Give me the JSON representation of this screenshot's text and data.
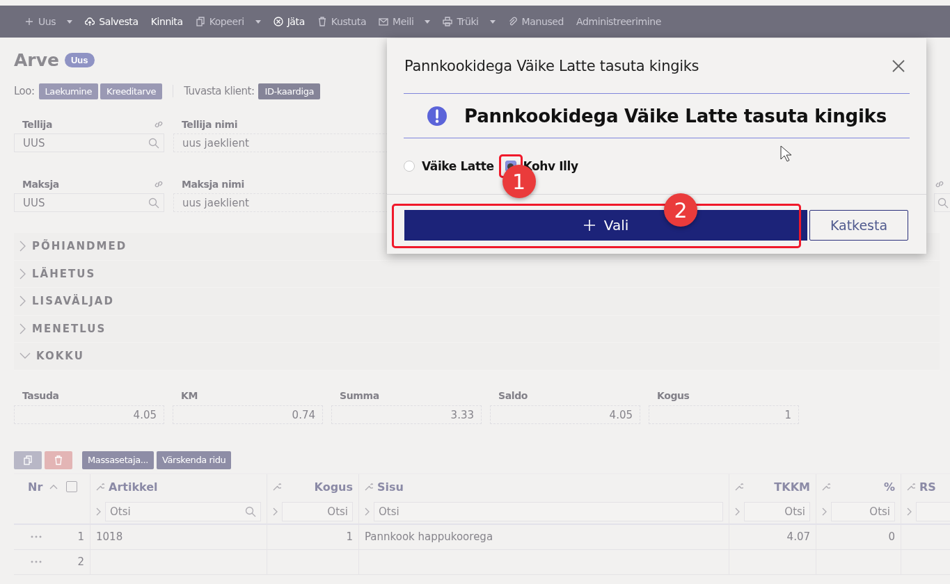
{
  "toolbar": {
    "items": [
      {
        "label": "Uus",
        "kind": "plus",
        "dropdown": true,
        "disabled": true
      },
      {
        "label": "Salvesta",
        "kind": "upload",
        "dropdown": false,
        "disabled": false
      },
      {
        "label": "Kinnita",
        "kind": "plain",
        "dropdown": false,
        "disabled": false
      },
      {
        "label": "Kopeeri",
        "kind": "copy",
        "dropdown": true,
        "disabled": true
      },
      {
        "label": "Jäta",
        "kind": "cancel",
        "dropdown": false,
        "disabled": false
      },
      {
        "label": "Kustuta",
        "kind": "trash",
        "dropdown": false,
        "disabled": true
      },
      {
        "label": "Meili",
        "kind": "mail",
        "dropdown": true,
        "disabled": true
      },
      {
        "label": "Trüki",
        "kind": "print",
        "dropdown": true,
        "disabled": true
      },
      {
        "label": "Manused",
        "kind": "clip",
        "dropdown": false,
        "disabled": true
      },
      {
        "label": "Administreerimine",
        "kind": "plain",
        "dropdown": false,
        "disabled": true
      }
    ]
  },
  "header": {
    "title": "Arve",
    "badge": "Uus",
    "create_label": "Loo:",
    "create_buttons": [
      "Laekumine",
      "Kreeditarve"
    ],
    "identify_label": "Tuvasta klient:",
    "identify_button": "ID-kaardiga"
  },
  "field_rows": [
    [
      {
        "label": "Tellija",
        "value": "UUS",
        "kind": "lookup"
      },
      {
        "label": "Tellija nimi",
        "value": "uus jaeklient",
        "kind": "text"
      }
    ],
    [
      {
        "label": "Maksja",
        "value": "UUS",
        "kind": "lookup"
      },
      {
        "label": "Maksja nimi",
        "value": "uus jaeklient",
        "kind": "text"
      },
      {
        "kind": "cut"
      }
    ]
  ],
  "sections": [
    {
      "label": "PÕHIANDMED",
      "expanded": false
    },
    {
      "label": "LÄHETUS",
      "expanded": false
    },
    {
      "label": "LISAVÄLJAD",
      "expanded": false
    },
    {
      "label": "MENETLUS",
      "expanded": false
    },
    {
      "label": "KOKKU",
      "expanded": true
    }
  ],
  "totals": [
    {
      "label": "Tasuda",
      "value": "4.05"
    },
    {
      "label": "KM",
      "value": "0.74"
    },
    {
      "label": "Summa",
      "value": "3.33"
    },
    {
      "label": "Saldo",
      "value": "4.05"
    },
    {
      "label": "Kogus",
      "value": "1"
    }
  ],
  "table_toolbar": {
    "buttons": [
      "Massasetaja...",
      "Värskenda ridu"
    ]
  },
  "table": {
    "select_all_checked": false,
    "columns": [
      {
        "label": "Nr"
      },
      {
        "label": "Artikkel",
        "filter": "Otsi"
      },
      {
        "label": "Kogus",
        "filter": "Otsi"
      },
      {
        "label": "Sisu",
        "filter": "Otsi"
      },
      {
        "label": "TKKM",
        "filter": "Otsi"
      },
      {
        "label": "%",
        "filter": "Otsi"
      },
      {
        "label": "RS"
      }
    ],
    "rows": [
      {
        "cells": [
          "1",
          "1018",
          "1",
          "Pannkook happukoorega",
          "4.07",
          "0",
          ""
        ]
      },
      {
        "cells": [
          "2",
          "",
          "",
          "",
          "",
          "",
          ""
        ]
      }
    ]
  },
  "dialog": {
    "title": "Pannkookidega Väike Latte tasuta kingiks",
    "heading": "Pannkookidega Väike Latte tasuta kingiks",
    "options": [
      {
        "label": "Väike Latte",
        "selected": false
      },
      {
        "label": "Kohv Illy",
        "selected": true
      }
    ],
    "confirm_button": "Vali",
    "cancel_button": "Katkesta"
  },
  "annotations": [
    {
      "label": "1"
    },
    {
      "label": "2"
    }
  ]
}
